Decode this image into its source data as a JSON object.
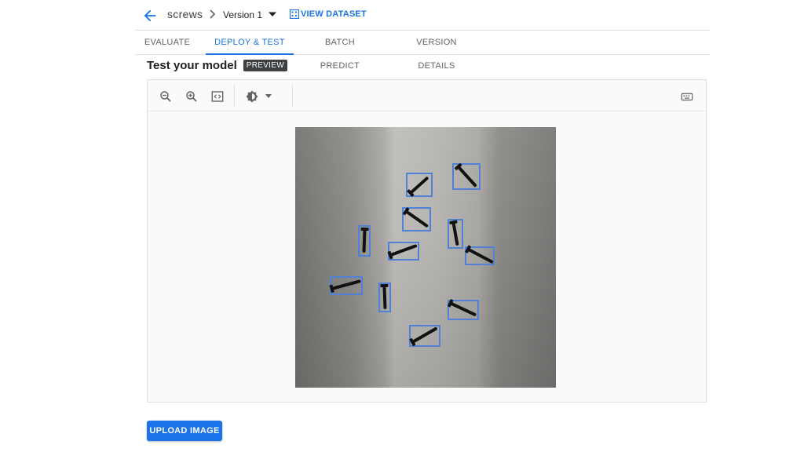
{
  "header": {
    "dataset_name": "screws",
    "version_label": "Version 1",
    "view_dataset_label": "VIEW DATASET",
    "back_icon": "arrow-back-icon",
    "accent_color": "#1a73e8"
  },
  "tabs": [
    {
      "label": "EVALUATE",
      "active": false
    },
    {
      "label": "DEPLOY & TEST",
      "active": true
    },
    {
      "label": "BATCH PREDICT",
      "active": false
    },
    {
      "label": "VERSION DETAILS",
      "active": false
    }
  ],
  "section": {
    "title": "Test your model",
    "badge": "PREVIEW"
  },
  "toolbar": {
    "icons": [
      "zoom-out-icon",
      "zoom-in-icon",
      "fit-to-screen-icon",
      "brightness-icon",
      "keyboard-icon"
    ]
  },
  "image": {
    "subject": "screws",
    "detection_count": 12,
    "box_color": "#4f82d6"
  },
  "upload": {
    "label": "UPLOAD IMAGE"
  }
}
